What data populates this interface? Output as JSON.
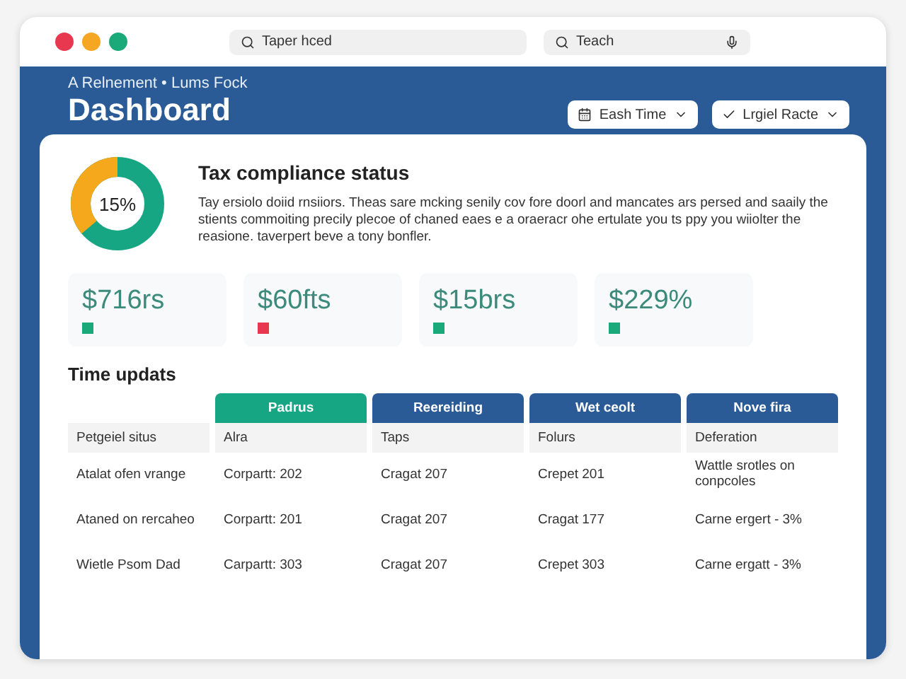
{
  "window": {
    "controls": [
      {
        "color": "#e8384f"
      },
      {
        "color": "#f5a623"
      },
      {
        "color": "#1aaa7a"
      }
    ],
    "search_fields": [
      {
        "placeholder": "Taper hced",
        "mic": false
      },
      {
        "placeholder": "Teach",
        "mic": true
      }
    ]
  },
  "header": {
    "subtitle": "A Relnement • Lums Fock",
    "title": "Dashboard",
    "buttons": [
      {
        "kind": "calendar",
        "label": "Eash Time"
      },
      {
        "kind": "check",
        "label": "Lrgiel Racte"
      }
    ]
  },
  "status": {
    "title": "Tax compliance status",
    "reading": "15%",
    "level": 0.36,
    "text": "Tay ersiolo doiid rnsiiors. Theas sare mcking senily cov fore doorl and mancates ars persed and saaily the stients commoiting precily plecoe of chaned eaes e a oraeracr ohe ertulate you ts ppy you wiiolter the reasione. taverpert beve a tony bonfler."
  },
  "stat_cards": [
    {
      "value": "$716rs",
      "color": "#1aaa7a"
    },
    {
      "value": "$60fts",
      "color": "#e8384f"
    },
    {
      "value": "$15brs",
      "color": "#1aaa7a"
    },
    {
      "value": "$229%",
      "color": "#1aaa7a"
    }
  ],
  "table": {
    "title": "Time updats",
    "columns": [
      {
        "kind": "blank"
      },
      {
        "kind": "tab",
        "label": "Padrus",
        "selected": true
      },
      {
        "kind": "tab",
        "label": "Reereiding",
        "selected": false
      },
      {
        "kind": "tab",
        "label": "Wet ceolt",
        "selected": false
      },
      {
        "kind": "tab",
        "label": "Nove fira",
        "selected": false
      }
    ],
    "subheader": [
      "Petgeiel situs",
      "Alra",
      "Taps",
      "Folurs",
      "Deferation"
    ],
    "rows": [
      [
        "Atalat ofen vrange",
        "Corpartt: 202",
        "Cragat 207",
        "Crepet 201",
        "Wattle srotles on conpcoles"
      ],
      [
        "Ataned on rercaheo",
        "Corpartt: 201",
        "Cragat 207",
        "Cragat 177",
        "Carne ergert - 3%"
      ],
      [
        "Wietle Psom Dad",
        "Carpartt: 303",
        "Cragat 207",
        "Crepet 303",
        "Carne ergatt - 3%"
      ]
    ]
  }
}
